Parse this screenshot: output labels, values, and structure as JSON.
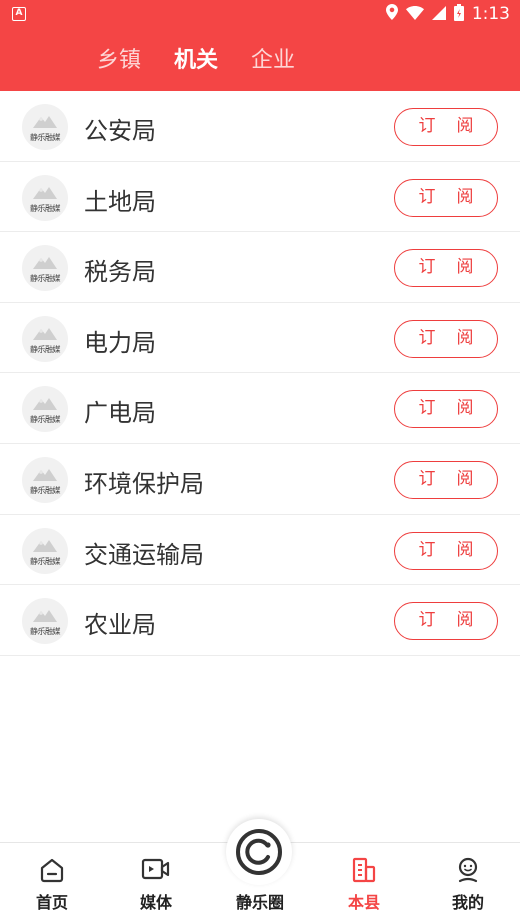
{
  "status_bar": {
    "app_indicator": "A",
    "time": "1:13",
    "icons": [
      "location-icon",
      "wifi-icon",
      "signal-icon",
      "battery-icon"
    ]
  },
  "tabs": [
    {
      "label": "乡镇",
      "active": false
    },
    {
      "label": "机关",
      "active": true
    },
    {
      "label": "企业",
      "active": false
    }
  ],
  "logo_text": "静乐融媒",
  "subscribe_label": "订阅",
  "items": [
    {
      "name": "公安局"
    },
    {
      "name": "土地局"
    },
    {
      "name": "税务局"
    },
    {
      "name": "电力局"
    },
    {
      "name": "广电局"
    },
    {
      "name": "环境保护局"
    },
    {
      "name": "交通运输局"
    },
    {
      "name": "农业局"
    }
  ],
  "bottom_nav": [
    {
      "label": "首页",
      "icon": "home-icon",
      "active": false
    },
    {
      "label": "媒体",
      "icon": "video-icon",
      "active": false
    },
    {
      "label": "静乐圈",
      "icon": "circle-logo-icon",
      "active": false
    },
    {
      "label": "本县",
      "icon": "building-icon",
      "active": true
    },
    {
      "label": "我的",
      "icon": "profile-icon",
      "active": false
    }
  ],
  "colors": {
    "brand": "#f44545",
    "subscribe": "#ee3e3e"
  }
}
